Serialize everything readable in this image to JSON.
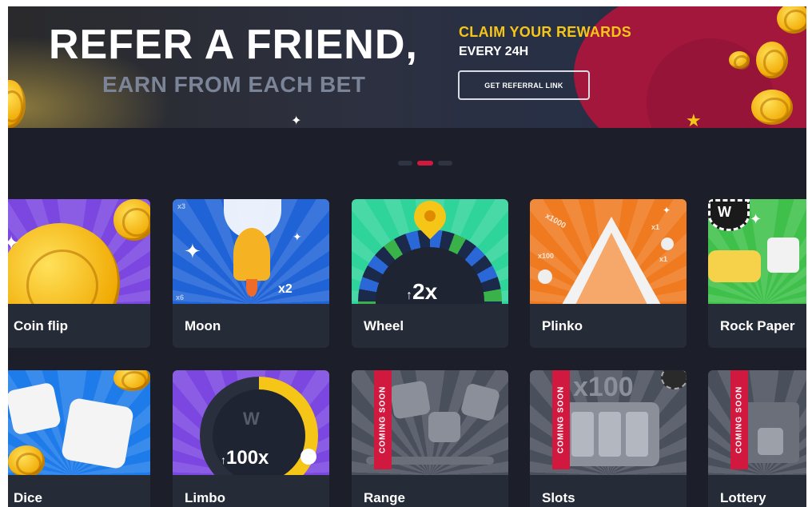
{
  "banner": {
    "headline": "REFER A FRIEND,",
    "subline": "EARN FROM EACH BET",
    "claim": "CLAIM YOUR REWARDS",
    "every": "EVERY 24H",
    "button": "GET REFERRAL LINK"
  },
  "carousel": {
    "slides": 3,
    "active_index": 1
  },
  "colors": {
    "background": "#1c1f2a",
    "card": "#262b38",
    "accent_red": "#d1193f",
    "gold": "#f5c518"
  },
  "games": [
    {
      "label": "Coin flip"
    },
    {
      "label": "Moon",
      "badge": "x2",
      "corner_a": "x3",
      "corner_b": "x6"
    },
    {
      "label": "Wheel",
      "multiplier": "2x"
    },
    {
      "label": "Plinko",
      "m1": "x1000",
      "m2": "x100",
      "m3": "x1",
      "m4": "x1"
    },
    {
      "label": "Rock Paper",
      "corner": "W"
    },
    {
      "label": "Dice"
    },
    {
      "label": "Limbo",
      "multiplier": "100x",
      "coin_letter": "W"
    },
    {
      "label": "Range",
      "coming_soon": "COMING SOON"
    },
    {
      "label": "Slots",
      "coming_soon": "COMING SOON",
      "multiplier": "x100"
    },
    {
      "label": "Lottery",
      "coming_soon": "COMING SOON"
    }
  ]
}
